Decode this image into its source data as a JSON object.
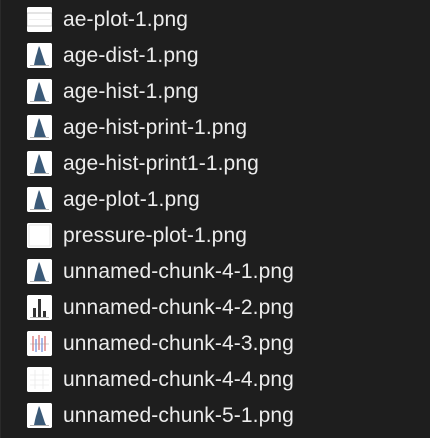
{
  "files": [
    {
      "name": "ae-plot-1.png",
      "thumbnail_icon": "wide-plot-thumbnail-icon"
    },
    {
      "name": "age-dist-1.png",
      "thumbnail_icon": "histogram-thumbnail-icon"
    },
    {
      "name": "age-hist-1.png",
      "thumbnail_icon": "histogram-thumbnail-icon"
    },
    {
      "name": "age-hist-print-1.png",
      "thumbnail_icon": "histogram-thumbnail-icon"
    },
    {
      "name": "age-hist-print1-1.png",
      "thumbnail_icon": "histogram-thumbnail-icon"
    },
    {
      "name": "age-plot-1.png",
      "thumbnail_icon": "histogram-thumbnail-icon"
    },
    {
      "name": "pressure-plot-1.png",
      "thumbnail_icon": "blank-plot-thumbnail-icon"
    },
    {
      "name": "unnamed-chunk-4-1.png",
      "thumbnail_icon": "histogram-thumbnail-icon"
    },
    {
      "name": "unnamed-chunk-4-2.png",
      "thumbnail_icon": "bar-chart-thumbnail-icon"
    },
    {
      "name": "unnamed-chunk-4-3.png",
      "thumbnail_icon": "multi-line-thumbnail-icon"
    },
    {
      "name": "unnamed-chunk-4-4.png",
      "thumbnail_icon": "faint-grid-thumbnail-icon"
    },
    {
      "name": "unnamed-chunk-5-1.png",
      "thumbnail_icon": "histogram-thumbnail-icon"
    }
  ],
  "colors": {
    "background": "#1e1e1e",
    "text": "#ececec",
    "thumbnail_background": "#ffffff",
    "histogram_fill": "#3b5a78"
  }
}
